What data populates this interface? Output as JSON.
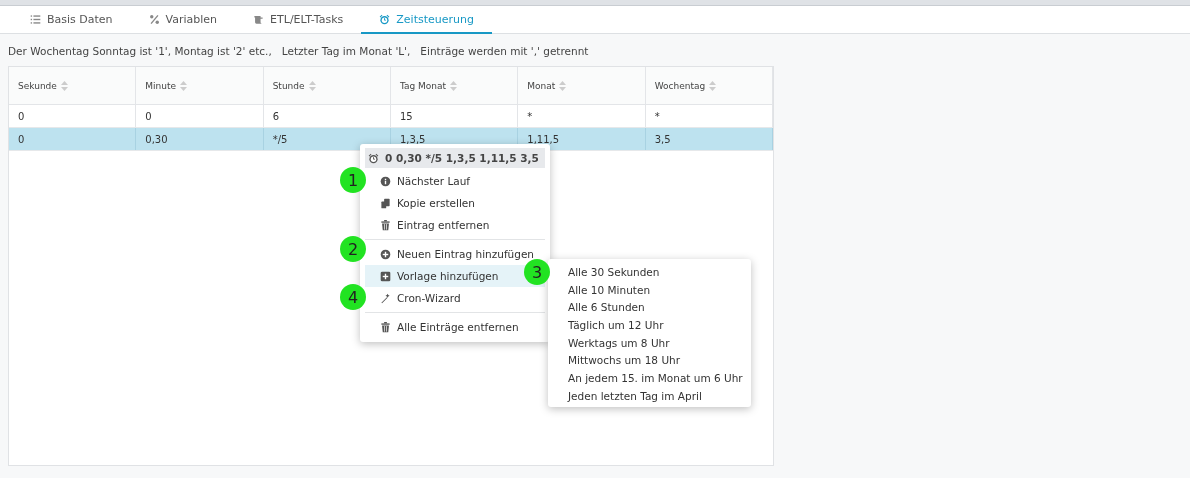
{
  "tabs": [
    {
      "label": "Basis Daten",
      "selected": false
    },
    {
      "label": "Variablen",
      "selected": false
    },
    {
      "label": "ETL/ELT-Tasks",
      "selected": false
    },
    {
      "label": "Zeitsteuerung",
      "selected": true
    }
  ],
  "hint": "Der Wochentag Sonntag ist '1', Montag ist '2' etc.,   Letzter Tag im Monat 'L',   Einträge werden mit ',' getrennt",
  "table": {
    "columns": [
      "Sekunde",
      "Minute",
      "Stunde",
      "Tag Monat",
      "Monat",
      "Wochentag"
    ],
    "rows": [
      {
        "cells": [
          "0",
          "0",
          "6",
          "15",
          "*",
          "*"
        ],
        "selected": false
      },
      {
        "cells": [
          "0",
          "0,30",
          "*/5",
          "1,3,5",
          "1,11,5",
          "3,5"
        ],
        "selected": true
      }
    ]
  },
  "context_menu": {
    "title": "0 0,30 */5 1,3,5 1,11,5 3,5",
    "items": [
      {
        "kind": "item",
        "label": "Nächster Lauf",
        "selected": false
      },
      {
        "kind": "item",
        "label": "Kopie erstellen",
        "selected": false
      },
      {
        "kind": "item",
        "label": "Eintrag entfernen",
        "selected": false
      },
      {
        "kind": "separator"
      },
      {
        "kind": "item",
        "label": "Neuen Eintrag hinzufügen",
        "selected": false
      },
      {
        "kind": "item",
        "label": "Vorlage hinzufügen",
        "selected": true
      },
      {
        "kind": "item",
        "label": "Cron-Wizard",
        "selected": false
      },
      {
        "kind": "separator"
      },
      {
        "kind": "item",
        "label": "Alle Einträge entfernen",
        "selected": false
      }
    ]
  },
  "submenu": [
    "Alle 30 Sekunden",
    "Alle 10 Minuten",
    "Alle 6 Stunden",
    "Täglich um 12 Uhr",
    "Werktags um 8 Uhr",
    "Mittwochs um 18 Uhr",
    "An jedem 15. im Monat um 6 Uhr",
    "Jeden letzten Tag im April"
  ],
  "markers": [
    "1",
    "2",
    "3",
    "4"
  ]
}
